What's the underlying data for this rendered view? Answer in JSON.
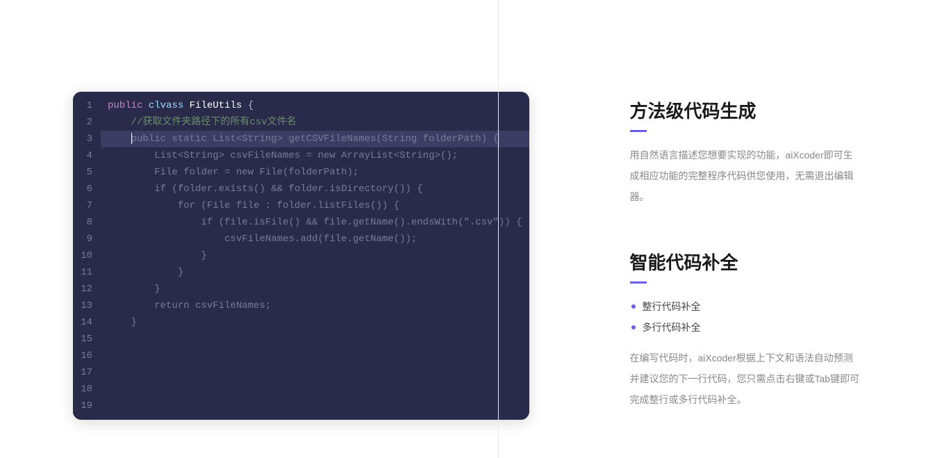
{
  "code": {
    "lines": [
      {
        "n": 1,
        "segments": [
          {
            "t": "keyword",
            "v": "public"
          },
          {
            "t": "plain",
            "v": " "
          },
          {
            "t": "keyword2",
            "v": "clvass"
          },
          {
            "t": "plain",
            "v": " "
          },
          {
            "t": "class",
            "v": "FileUtils"
          },
          {
            "t": "plain",
            "v": " "
          },
          {
            "t": "punct",
            "v": "{"
          }
        ]
      },
      {
        "n": 2,
        "segments": [
          {
            "t": "plain",
            "v": "    "
          },
          {
            "t": "comment",
            "v": "//获取文件夹路径下的所有csv文件名"
          }
        ]
      },
      {
        "n": 3,
        "highlighted": true,
        "segments": [
          {
            "t": "plain",
            "v": "    "
          },
          {
            "t": "cursor",
            "v": ""
          },
          {
            "t": "suggested",
            "v": "public static List<String> getCSVFileNames(String folderPath) {"
          }
        ]
      },
      {
        "n": 4,
        "segments": [
          {
            "t": "plain",
            "v": "        "
          },
          {
            "t": "suggested",
            "v": "List<String> csvFileNames = new ArrayList<String>();"
          }
        ]
      },
      {
        "n": 5,
        "segments": [
          {
            "t": "plain",
            "v": "        "
          },
          {
            "t": "suggested",
            "v": "File folder = new File(folderPath);"
          }
        ]
      },
      {
        "n": 6,
        "segments": [
          {
            "t": "plain",
            "v": "        "
          },
          {
            "t": "suggested",
            "v": "if (folder.exists() && folder.isDirectory()) {"
          }
        ]
      },
      {
        "n": 7,
        "segments": [
          {
            "t": "plain",
            "v": "            "
          },
          {
            "t": "suggested",
            "v": "for (File file : folder.listFiles()) {"
          }
        ]
      },
      {
        "n": 8,
        "segments": [
          {
            "t": "plain",
            "v": "                "
          },
          {
            "t": "suggested",
            "v": "if (file.isFile() && file.getName().endsWith(\".csv\")) {"
          }
        ]
      },
      {
        "n": 9,
        "segments": [
          {
            "t": "plain",
            "v": "                    "
          },
          {
            "t": "suggested",
            "v": "csvFileNames.add(file.getName());"
          }
        ]
      },
      {
        "n": 10,
        "segments": [
          {
            "t": "plain",
            "v": "                "
          },
          {
            "t": "suggested",
            "v": "}"
          }
        ]
      },
      {
        "n": 11,
        "segments": [
          {
            "t": "plain",
            "v": "            "
          },
          {
            "t": "suggested",
            "v": "}"
          }
        ]
      },
      {
        "n": 12,
        "segments": [
          {
            "t": "plain",
            "v": "        "
          },
          {
            "t": "suggested",
            "v": "}"
          }
        ]
      },
      {
        "n": 13,
        "segments": [
          {
            "t": "plain",
            "v": "        "
          },
          {
            "t": "suggested",
            "v": "return csvFileNames;"
          }
        ]
      },
      {
        "n": 14,
        "segments": [
          {
            "t": "plain",
            "v": "    "
          },
          {
            "t": "suggested",
            "v": "}"
          }
        ]
      },
      {
        "n": 15,
        "segments": []
      },
      {
        "n": 16,
        "segments": []
      },
      {
        "n": 17,
        "segments": []
      },
      {
        "n": 18,
        "segments": []
      },
      {
        "n": 19,
        "segments": []
      }
    ]
  },
  "sections": [
    {
      "title": "方法级代码生成",
      "desc": "用自然语言描述您想要实现的功能，aiXcoder即可生成相应功能的完整程序代码供您使用，无需退出编辑器。"
    },
    {
      "title": "智能代码补全",
      "bullets": [
        "整行代码补全",
        "多行代码补全"
      ],
      "desc": "在编写代码时，aiXcoder根据上下文和语法自动预测并建议您的下一行代码，您只需点击右键或Tab键即可完成整行或多行代码补全。"
    }
  ]
}
